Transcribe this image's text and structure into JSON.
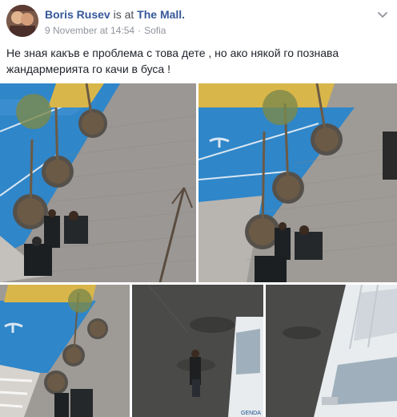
{
  "post": {
    "author": "Boris Rusev",
    "is_at": "is at",
    "place": "The Mall.",
    "date": "9 November at 14:54",
    "separator": "·",
    "location": "Sofia",
    "text": "Не зная какъв е проблема с това дете , но ако някой го познава жандармерията го качи в буса !",
    "van_text": "GENDA"
  },
  "icons": {
    "menu": "chevron-down-icon"
  },
  "colors": {
    "author_link": "#365899",
    "meta": "#90949c",
    "parking_blue": "#2f86c9"
  }
}
